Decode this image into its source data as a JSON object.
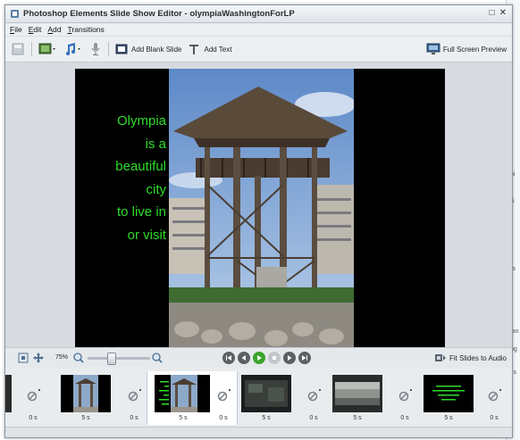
{
  "window": {
    "title": "Photoshop Elements Slide Show Editor - olympiaWashingtonForLP",
    "controls": [
      "□",
      "✕"
    ]
  },
  "menu": [
    "File",
    "Edit",
    "Add",
    "Transitions"
  ],
  "toolbar": {
    "add_blank_slide": "Add Blank Slide",
    "add_text": "Add Text",
    "full_screen_preview": "Full Screen Preview"
  },
  "slide": {
    "text_lines": [
      "Olympia",
      "is a",
      "beautiful",
      "city",
      "to live in",
      "or visit"
    ],
    "text_color": "#2fdc2b"
  },
  "controls": {
    "zoom_percent": "75%",
    "fit_slides_to_audio": "Fit Slides to Audio"
  },
  "filmstrip": {
    "slide_durations": [
      "5 s",
      "5 s",
      "5 s",
      "5 s",
      "5 s"
    ],
    "transition_durations": [
      "0 s",
      "0 s",
      "0 s",
      "0 s",
      "0 s",
      "0 s"
    ],
    "selected_index": 1
  },
  "background_window": {
    "edge_fragments": [
      "pi",
      "S",
      "rs",
      "lan",
      "ng",
      "its"
    ]
  },
  "colors": {
    "accent_green": "#2fdc2b",
    "play_green": "#3aa52a"
  }
}
